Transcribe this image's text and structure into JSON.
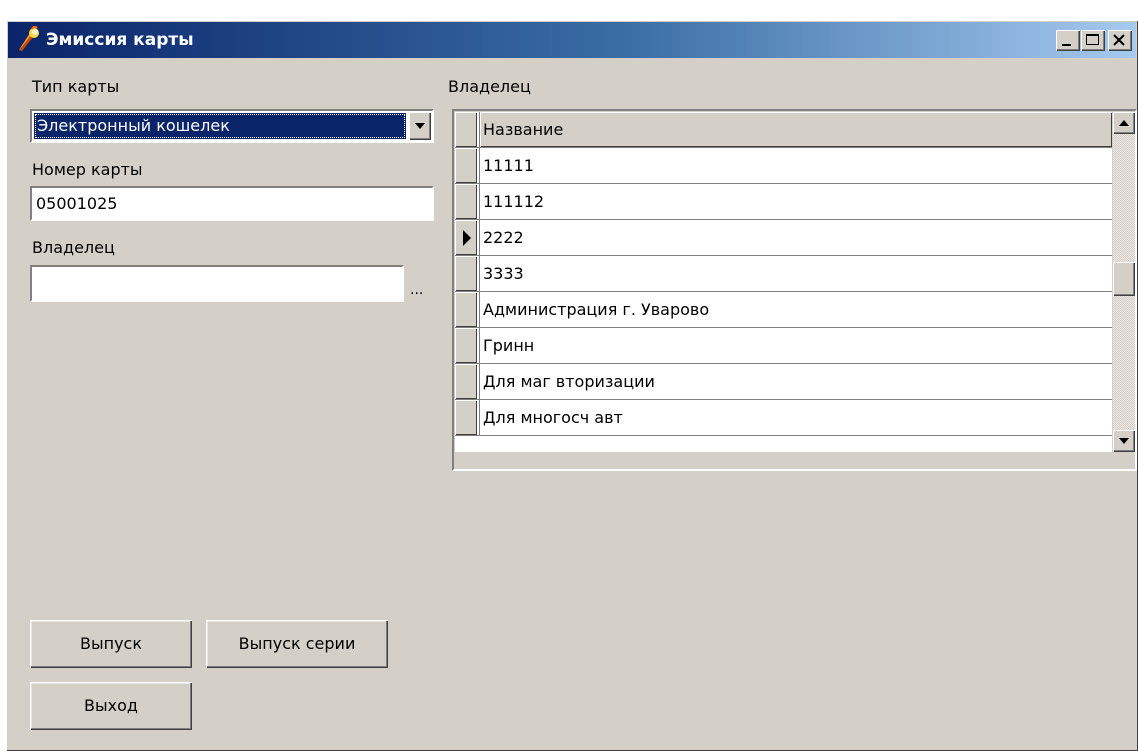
{
  "window": {
    "title": "Эмиссия карты"
  },
  "left": {
    "card_type_label": "Тип карты",
    "card_type_value": "Электронный кошелек",
    "card_number_label": "Номер карты",
    "card_number_value": "05001025",
    "owner_label": "Владелец",
    "owner_value": "",
    "browse_label": "..."
  },
  "grid": {
    "label": "Владелец",
    "column_header": "Название",
    "rows": [
      "11111",
      "111112",
      "2222",
      "3333",
      "Администрация г. Уварово",
      "Гринн",
      "Для маг вторизации",
      "Для многосч авт"
    ],
    "current_row": 2
  },
  "buttons": {
    "issue": "Выпуск",
    "issue_series": "Выпуск серии",
    "exit": "Выход"
  }
}
